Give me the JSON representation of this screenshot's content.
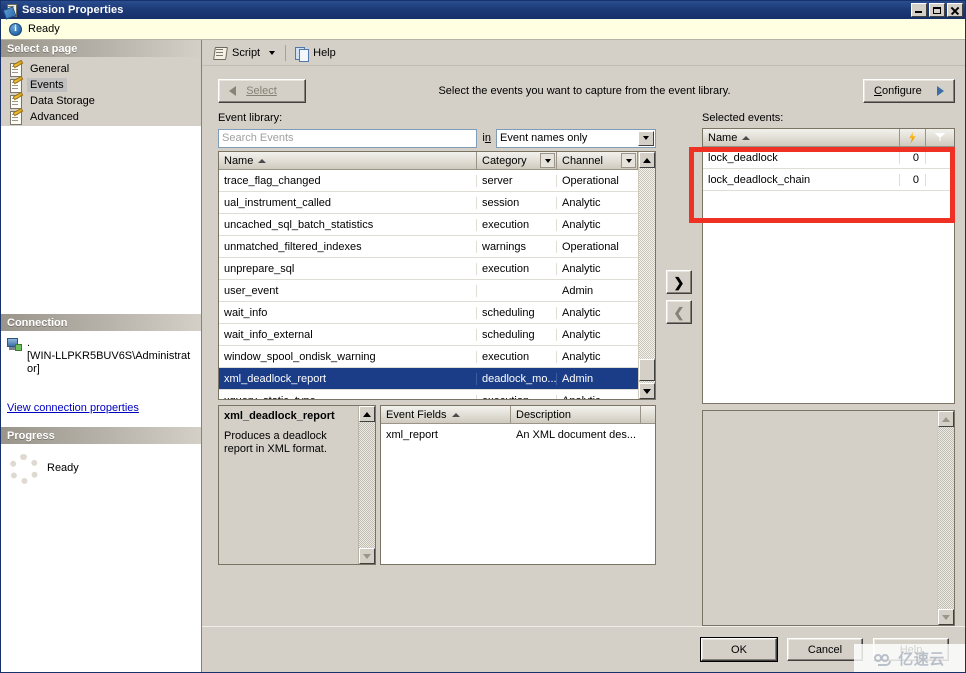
{
  "window": {
    "title": "Session Properties",
    "icon": "session-properties-icon",
    "controls": {
      "minimize": "Minimize",
      "maximize": "Maximize",
      "close": "Close"
    }
  },
  "status": {
    "text": "Ready",
    "icon": "info-icon"
  },
  "sidebar": {
    "header": "Select a page",
    "items": [
      {
        "label": "General",
        "selected": false
      },
      {
        "label": "Events",
        "selected": true
      },
      {
        "label": "Data Storage",
        "selected": false
      },
      {
        "label": "Advanced",
        "selected": false
      }
    ]
  },
  "connection": {
    "header": "Connection",
    "server": ".",
    "user": "[WIN-LLPKR5BUV6S\\Administrator]",
    "link": "View connection properties"
  },
  "progress": {
    "header": "Progress",
    "text": "Ready"
  },
  "toolbar": {
    "script_label": "Script",
    "help_label": "Help"
  },
  "main": {
    "select_button": "Select",
    "instruction": "Select the events you want to capture from the event library.",
    "configure_button": "Configure",
    "event_library_label": "Event library:",
    "search": {
      "placeholder": "Search Events",
      "value": ""
    },
    "in_label": "in",
    "scope_combo": {
      "value": "Event names only"
    },
    "library_grid": {
      "columns": [
        "Name",
        "Category",
        "Channel"
      ],
      "sort_column": "Name",
      "sort_direction": "asc",
      "rows": [
        {
          "name": "trace_flag_changed",
          "category": "server",
          "channel": "Operational",
          "selected": false
        },
        {
          "name": "ual_instrument_called",
          "category": "session",
          "channel": "Analytic",
          "selected": false
        },
        {
          "name": "uncached_sql_batch_statistics",
          "category": "execution",
          "channel": "Analytic",
          "selected": false
        },
        {
          "name": "unmatched_filtered_indexes",
          "category": "warnings",
          "channel": "Operational",
          "selected": false
        },
        {
          "name": "unprepare_sql",
          "category": "execution",
          "channel": "Analytic",
          "selected": false
        },
        {
          "name": "user_event",
          "category": "",
          "channel": "Admin",
          "selected": false
        },
        {
          "name": "wait_info",
          "category": "scheduling",
          "channel": "Analytic",
          "selected": false
        },
        {
          "name": "wait_info_external",
          "category": "scheduling",
          "channel": "Analytic",
          "selected": false
        },
        {
          "name": "window_spool_ondisk_warning",
          "category": "execution",
          "channel": "Analytic",
          "selected": false
        },
        {
          "name": "xml_deadlock_report",
          "category": "deadlock_mo...",
          "channel": "Admin",
          "selected": true
        },
        {
          "name": "xquery_static_type",
          "category": "execution",
          "channel": "Analytic",
          "selected": false
        }
      ]
    },
    "description_panel": {
      "title": "xml_deadlock_report",
      "text": "Produces a deadlock report in XML format."
    },
    "fields_grid": {
      "columns": [
        "Event Fields",
        "Description"
      ],
      "sort_column": "Event Fields",
      "sort_direction": "asc",
      "rows": [
        {
          "field": "xml_report",
          "description": "An XML document des..."
        }
      ]
    },
    "transfer": {
      "add": "❯",
      "remove": "❮"
    },
    "selected_events_label": "Selected events:",
    "selected_grid": {
      "columns": [
        "Name",
        "actions-column",
        "filter-column"
      ],
      "sort_column": "Name",
      "sort_direction": "asc",
      "header_icons": [
        "lightning-bolt-icon",
        "funnel-filter-icon"
      ],
      "rows": [
        {
          "name": "lock_deadlock",
          "count": "0"
        },
        {
          "name": "lock_deadlock_chain",
          "count": "0"
        }
      ]
    }
  },
  "footer": {
    "ok": "OK",
    "cancel": "Cancel",
    "help": "Help"
  },
  "annotation": {
    "highlight_color": "#ef3124",
    "target": "selected-events-grid"
  },
  "watermark": {
    "text": "亿速云"
  }
}
